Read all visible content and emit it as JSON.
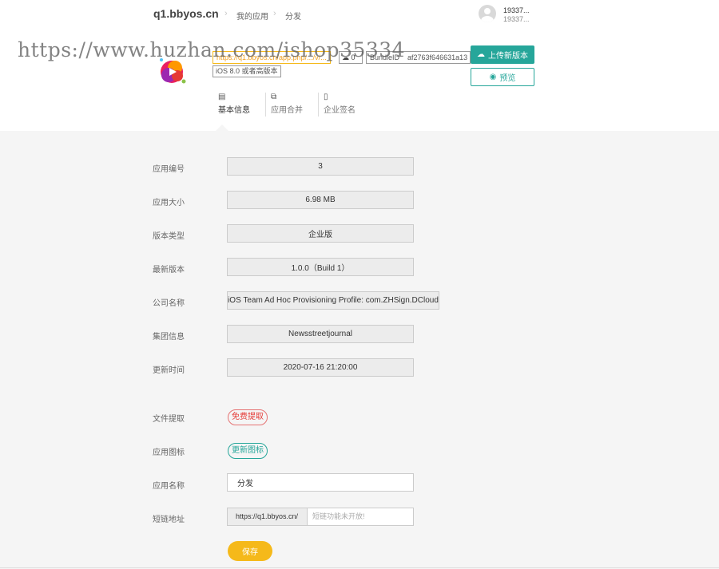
{
  "header": {
    "brand": "q1.bbyos.cn",
    "breadcrumb": [
      "我的应用",
      "分发"
    ],
    "user_line1": "19337...",
    "user_line2": "19337..."
  },
  "watermark": "https://www.huzhan.com/ishop35334",
  "app": {
    "link": "https://q1.bbyos.cn/app.php/.../v/...",
    "download_count": "0",
    "bundle_label": "BundleID",
    "bundle_value": "af2763f646631a13",
    "ios_requirement": "iOS 8.0 或者高版本",
    "upload_label": "上传新版本",
    "preview_label": "预览"
  },
  "tabs": [
    {
      "label": "基本信息"
    },
    {
      "label": "应用合并"
    },
    {
      "label": "企业签名"
    }
  ],
  "info": {
    "app_id_label": "应用编号",
    "app_id": "3",
    "size_label": "应用大小",
    "size": "6.98 MB",
    "type_label": "版本类型",
    "type": "企业版",
    "version_label": "最新版本",
    "version": "1.0.0（Build 1）",
    "company_label": "公司名称",
    "company": "iOS Team Ad Hoc Provisioning Profile: com.ZHSign.DCloud",
    "group_label": "集团信息",
    "group": "Newsstreetjournal",
    "updated_label": "更新时间",
    "updated": "2020-07-16 21:20:00"
  },
  "form": {
    "extract_label": "文件提取",
    "extract_tag": "免费提取",
    "icon_label": "应用图标",
    "icon_tag": "更新图标",
    "name_label": "应用名称",
    "name_value": "分发",
    "short_label": "短链地址",
    "short_prefix": "https://q1.bbyos.cn/",
    "short_placeholder": "短链功能未开放!",
    "save_label": "保存"
  }
}
